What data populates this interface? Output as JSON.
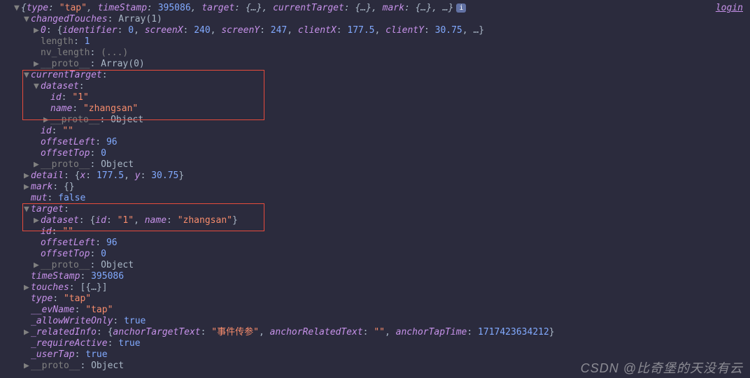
{
  "login_label": "login",
  "root": {
    "summary_open": "{",
    "type_key": "type",
    "type_val": "\"tap\"",
    "timeStamp_key": "timeStamp",
    "timeStamp_val": "395086",
    "target_key": "target",
    "target_val": "{…}",
    "currentTarget_key": "currentTarget",
    "currentTarget_val": "{…}",
    "mark_key": "mark",
    "mark_val": "{…}",
    "more": ", …}",
    "summary_close": "}"
  },
  "changedTouches": {
    "key": "changedTouches",
    "val": "Array(1)",
    "item0": {
      "idx": "0",
      "identifier_key": "identifier",
      "identifier_val": "0",
      "screenX_key": "screenX",
      "screenX_val": "240",
      "screenY_key": "screenY",
      "screenY_val": "247",
      "clientX_key": "clientX",
      "clientX_val": "177.5",
      "clientY_key": "clientY",
      "clientY_val": "30.75",
      "more": ", …}"
    },
    "length_key": "length",
    "length_val": "1",
    "nv_length_key": "nv_length",
    "nv_length_val": "(...)",
    "proto_key": "__proto__",
    "proto_val": "Array(0)"
  },
  "currentTarget": {
    "key": "currentTarget",
    "dataset_key": "dataset",
    "id_key": "id",
    "id_val": "\"1\"",
    "name_key": "name",
    "name_val": "\"zhangsan\"",
    "proto_key": "__proto__",
    "proto_val": "Object",
    "id2_key": "id",
    "id2_val": "\"\"",
    "offsetLeft_key": "offsetLeft",
    "offsetLeft_val": "96",
    "offsetTop_key": "offsetTop",
    "offsetTop_val": "0",
    "proto2_key": "__proto__",
    "proto2_val": "Object"
  },
  "detail": {
    "key": "detail",
    "x_key": "x",
    "x_val": "177.5",
    "y_key": "y",
    "y_val": "30.75"
  },
  "mark2": {
    "key": "mark",
    "val": "{}"
  },
  "mut": {
    "key": "mut",
    "val": "false"
  },
  "target": {
    "key": "target",
    "dataset_key": "dataset",
    "ds_id_key": "id",
    "ds_id_val": "\"1\"",
    "ds_name_key": "name",
    "ds_name_val": "\"zhangsan\"",
    "id_key": "id",
    "id_val": "\"\"",
    "offsetLeft_key": "offsetLeft",
    "offsetLeft_val": "96",
    "offsetTop_key": "offsetTop",
    "offsetTop_val": "0",
    "proto_key": "__proto__",
    "proto_val": "Object"
  },
  "timeStamp2": {
    "key": "timeStamp",
    "val": "395086"
  },
  "touches": {
    "key": "touches",
    "val": "[{…}]"
  },
  "type2": {
    "key": "type",
    "val": "\"tap\""
  },
  "evName": {
    "key": "__evName",
    "val": "\"tap\""
  },
  "allowWriteOnly": {
    "key": "_allowWriteOnly",
    "val": "true"
  },
  "relatedInfo": {
    "key": "_relatedInfo",
    "anchorTargetText_key": "anchorTargetText",
    "anchorTargetText_val": "\"事件传参\"",
    "anchorRelatedText_key": "anchorRelatedText",
    "anchorRelatedText_val": "\"\"",
    "anchorTapTime_key": "anchorTapTime",
    "anchorTapTime_val": "1717423634212"
  },
  "requireActive": {
    "key": "_requireActive",
    "val": "true"
  },
  "userTap": {
    "key": "_userTap",
    "val": "true"
  },
  "finalProto": {
    "key": "__proto__",
    "val": "Object"
  },
  "watermark": "CSDN @比奇堡的天没有云"
}
